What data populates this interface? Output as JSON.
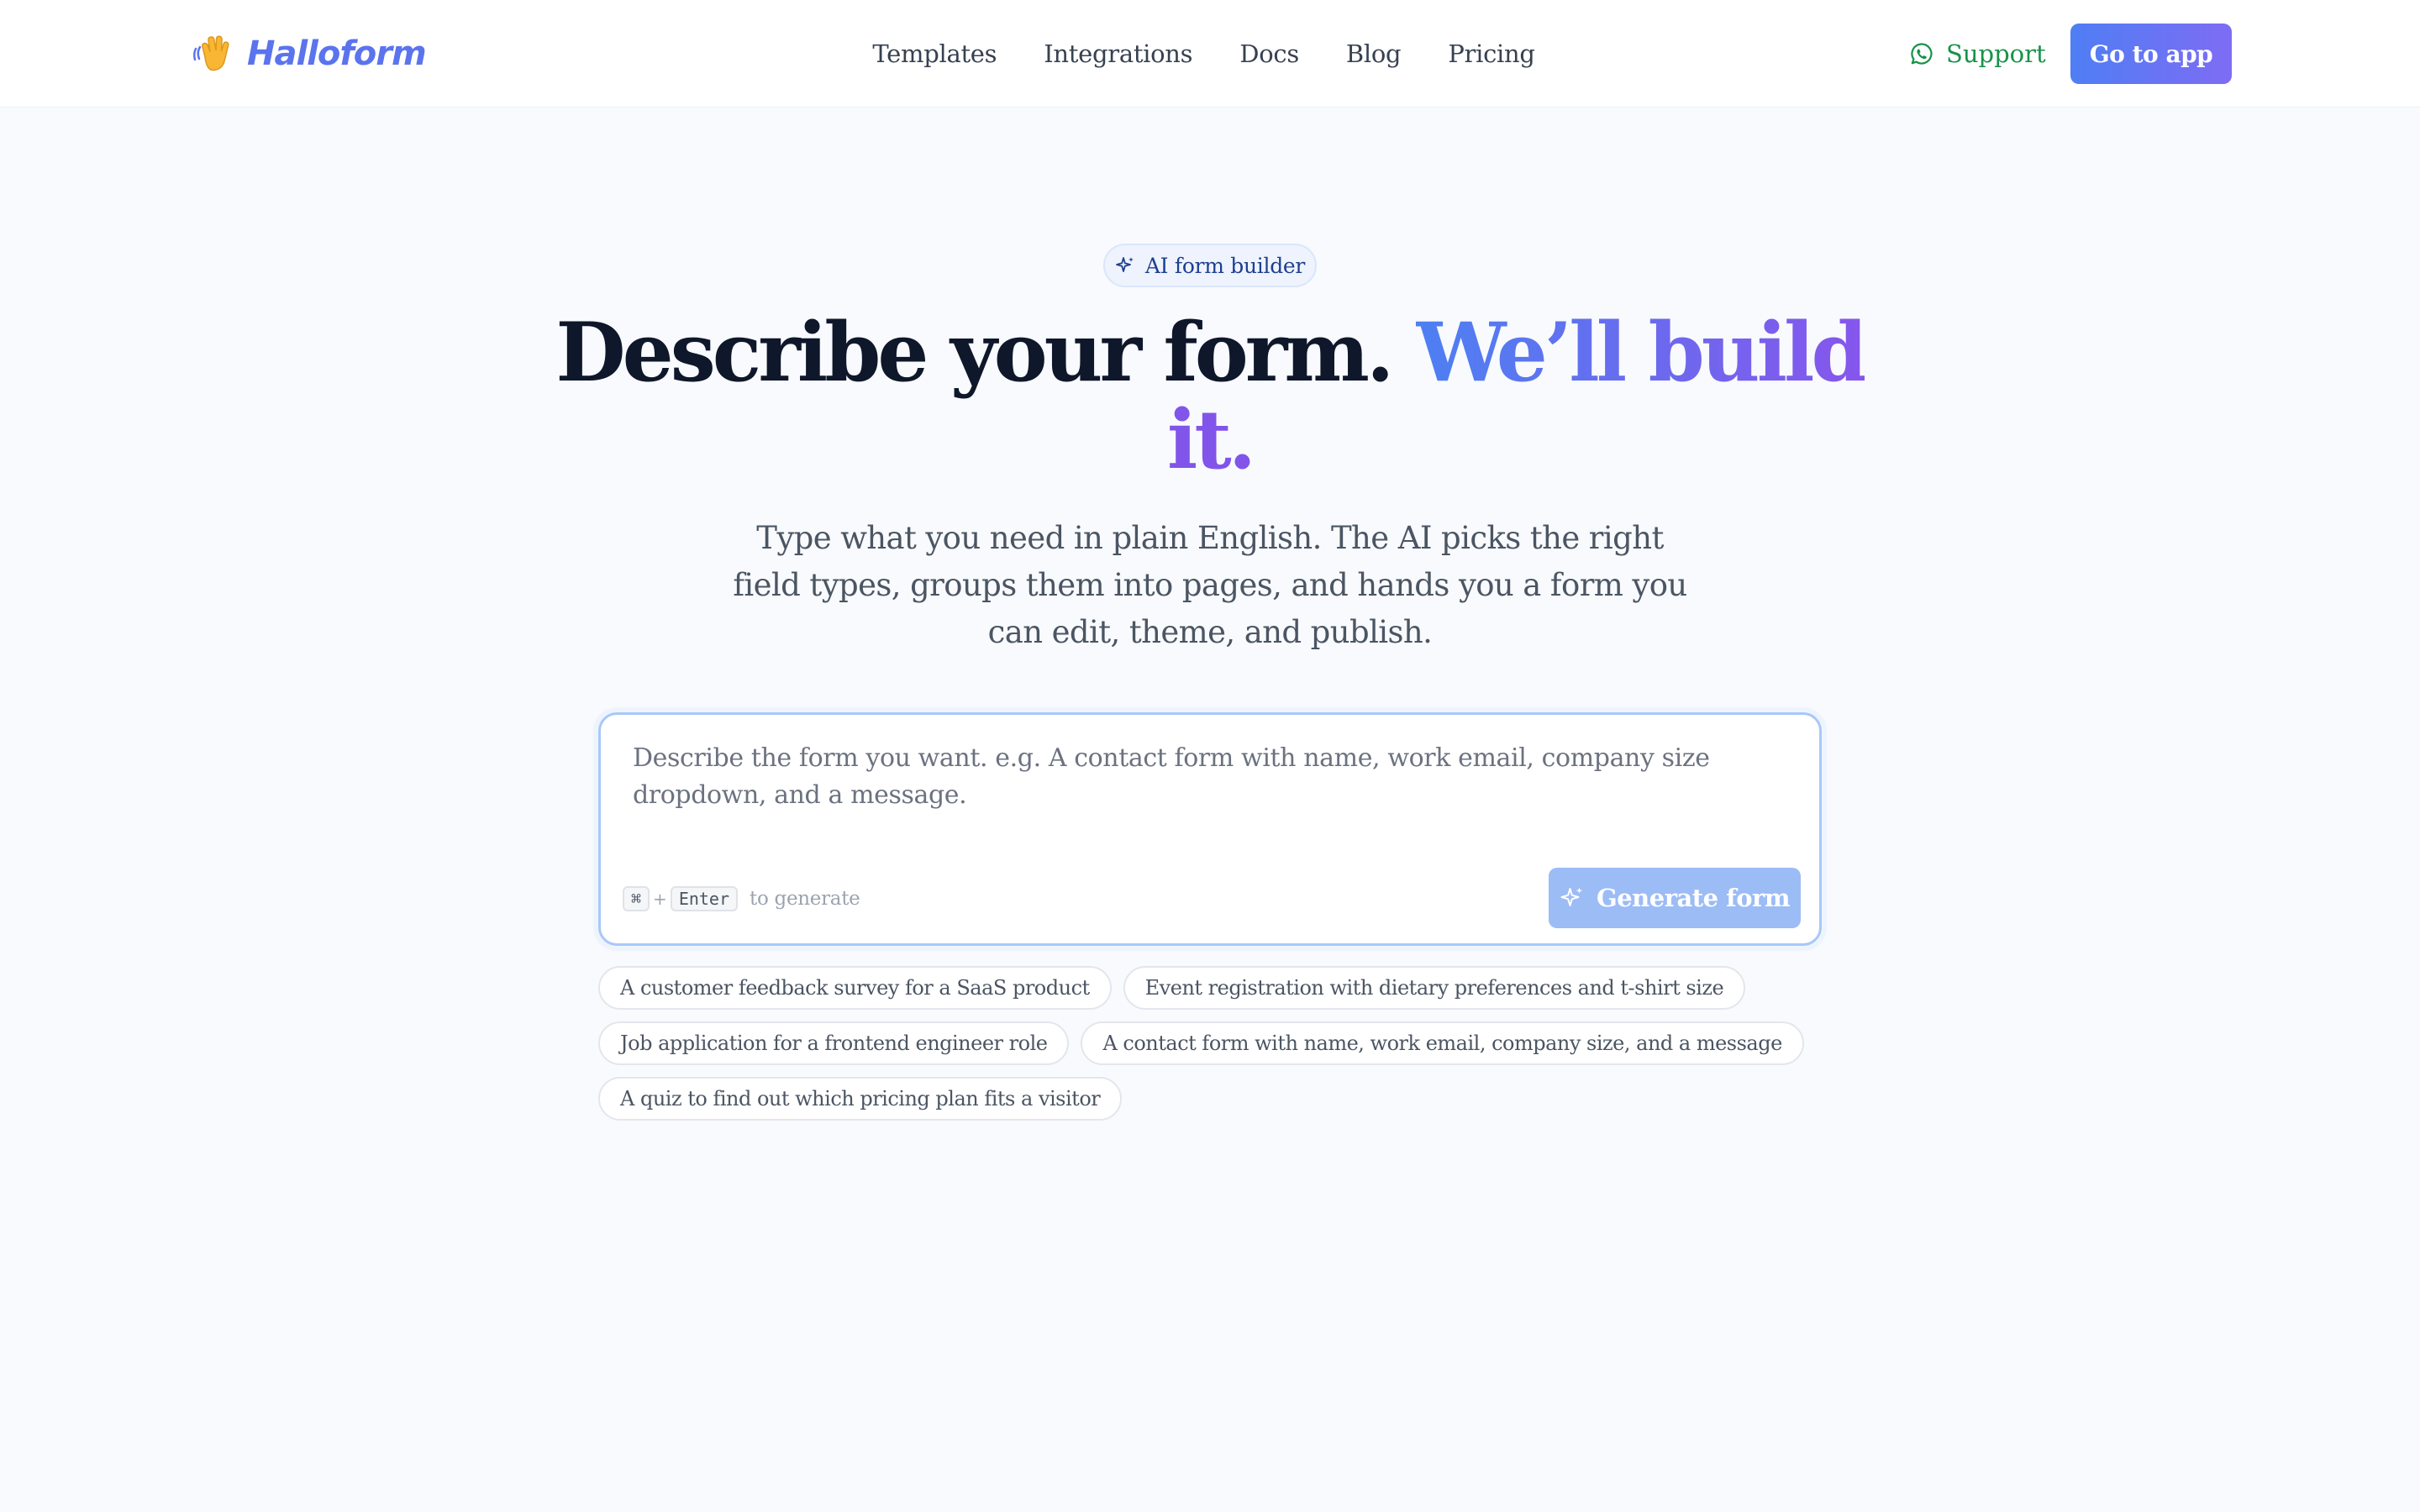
{
  "brand": {
    "name": "Halloform",
    "icon": "waving-hand-icon",
    "color": "#5b74ee"
  },
  "nav": {
    "items": [
      "Templates",
      "Integrations",
      "Docs",
      "Blog",
      "Pricing"
    ]
  },
  "header_actions": {
    "support_label": "Support",
    "support_icon": "whatsapp-icon",
    "support_color": "#16924a",
    "go_to_app_label": "Go to app"
  },
  "hero": {
    "badge": "AI form builder",
    "badge_icon": "sparkle-icon",
    "headline_main": "Describe your form.",
    "headline_accent_1": "We’ll build",
    "headline_accent_2": "it.",
    "subheadline": "Type what you need in plain English. The AI picks the right field types, groups them into pages, and hands you a form you can edit, theme, and publish."
  },
  "prompt": {
    "placeholder": "Describe the form you want. e.g. A contact form with name, work email, company size dropdown, and a message.",
    "value": "",
    "shortcut_key_1": "⌘",
    "shortcut_plus": "+",
    "shortcut_key_2": "Enter",
    "shortcut_hint": "to generate",
    "generate_label": "Generate form",
    "generate_icon": "sparkle-icon"
  },
  "suggestions": [
    "A customer feedback survey for a SaaS product",
    "Event registration with dietary preferences and t-shirt size",
    "Job application for a frontend engineer role",
    "A contact form with name, work email, company size, and a message",
    "A quiz to find out which pricing plan fits a visitor"
  ],
  "colors": {
    "accent_gradient_start": "#4f7ef4",
    "accent_gradient_end": "#7e6cf4",
    "generate_disabled": "#9cbcf6",
    "page_background": "#f8fafd"
  }
}
